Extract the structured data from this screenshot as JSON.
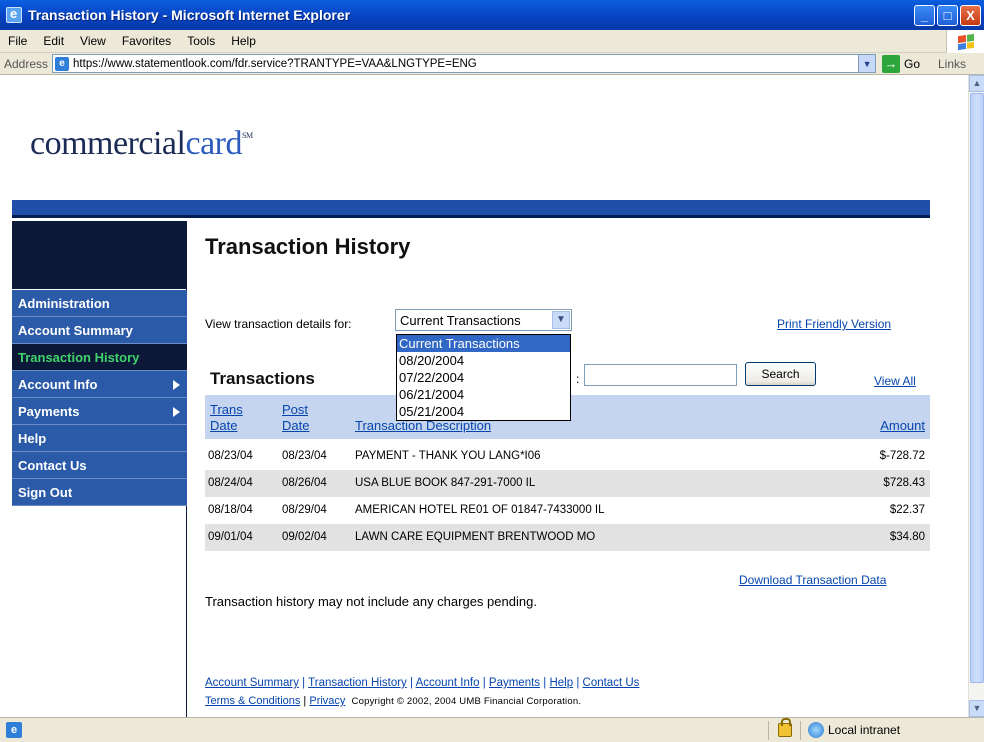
{
  "window": {
    "title": "Transaction History - Microsoft Internet Explorer",
    "minimize": "_",
    "maximize": "□",
    "close": "X"
  },
  "menu": [
    "File",
    "Edit",
    "View",
    "Favorites",
    "Tools",
    "Help"
  ],
  "address": {
    "label": "Address",
    "url": "https://www.statementlook.com/fdr.service?TRANTYPE=VAA&LNGTYPE=ENG",
    "go": "Go",
    "links": "Links"
  },
  "logo": {
    "part1": "commercial",
    "part2": "card",
    "mark": "SM"
  },
  "sidenav": [
    {
      "label": "Administration",
      "active": false,
      "arrow": false
    },
    {
      "label": "Account Summary",
      "active": false,
      "arrow": false
    },
    {
      "label": "Transaction History",
      "active": true,
      "arrow": false
    },
    {
      "label": "Account Info",
      "active": false,
      "arrow": true
    },
    {
      "label": "Payments",
      "active": false,
      "arrow": true
    },
    {
      "label": "Help",
      "active": false,
      "arrow": false
    },
    {
      "label": "Contact Us",
      "active": false,
      "arrow": false
    },
    {
      "label": "Sign Out",
      "active": false,
      "arrow": false
    }
  ],
  "page": {
    "title": "Transaction History",
    "view_label": "View transaction details for:",
    "select_value": "Current Transactions",
    "dropdown_options": [
      "Current Transactions",
      "08/20/2004",
      "07/22/2004",
      "06/21/2004",
      "05/21/2004"
    ],
    "print_link": "Print Friendly Version",
    "transactions_heading": "Transactions",
    "search_colon": ":",
    "search_value": "",
    "search_button": "Search",
    "view_all": "View All",
    "download_link": "Download Transaction Data",
    "note": "Transaction history may not include any charges pending."
  },
  "table": {
    "headers": {
      "trans_date_1": "Trans",
      "trans_date_2": "Date",
      "post_date_1": "Post",
      "post_date_2": "Date",
      "description": "Transaction Description",
      "amount": "Amount"
    },
    "rows": [
      {
        "trans": "08/23/04",
        "post": "08/23/04",
        "desc": "PAYMENT - THANK YOU LANG*I06",
        "amount": "$-728.72"
      },
      {
        "trans": "08/24/04",
        "post": "08/26/04",
        "desc": "USA BLUE BOOK 847-291-7000 IL",
        "amount": "$728.43"
      },
      {
        "trans": "08/18/04",
        "post": "08/29/04",
        "desc": "AMERICAN HOTEL RE01 OF 01847-7433000 IL",
        "amount": "$22.37"
      },
      {
        "trans": "09/01/04",
        "post": "09/02/04",
        "desc": "LAWN CARE EQUIPMENT BRENTWOOD MO",
        "amount": "$34.80"
      }
    ]
  },
  "footer": {
    "links": [
      "Account Summary",
      "Transaction History",
      "Account Info",
      "Payments",
      "Help",
      "Contact Us"
    ],
    "terms": "Terms & Conditions",
    "privacy": "Privacy",
    "copyright": "Copyright © 2002, 2004 UMB Financial Corporation."
  },
  "status": {
    "zone": "Local intranet"
  },
  "colors": {
    "nav_blue": "#2a5aa8",
    "nav_dark": "#0b1838",
    "active_green": "#3fd36a",
    "header_blue": "#c5d5f0",
    "link": "#0645ad"
  }
}
